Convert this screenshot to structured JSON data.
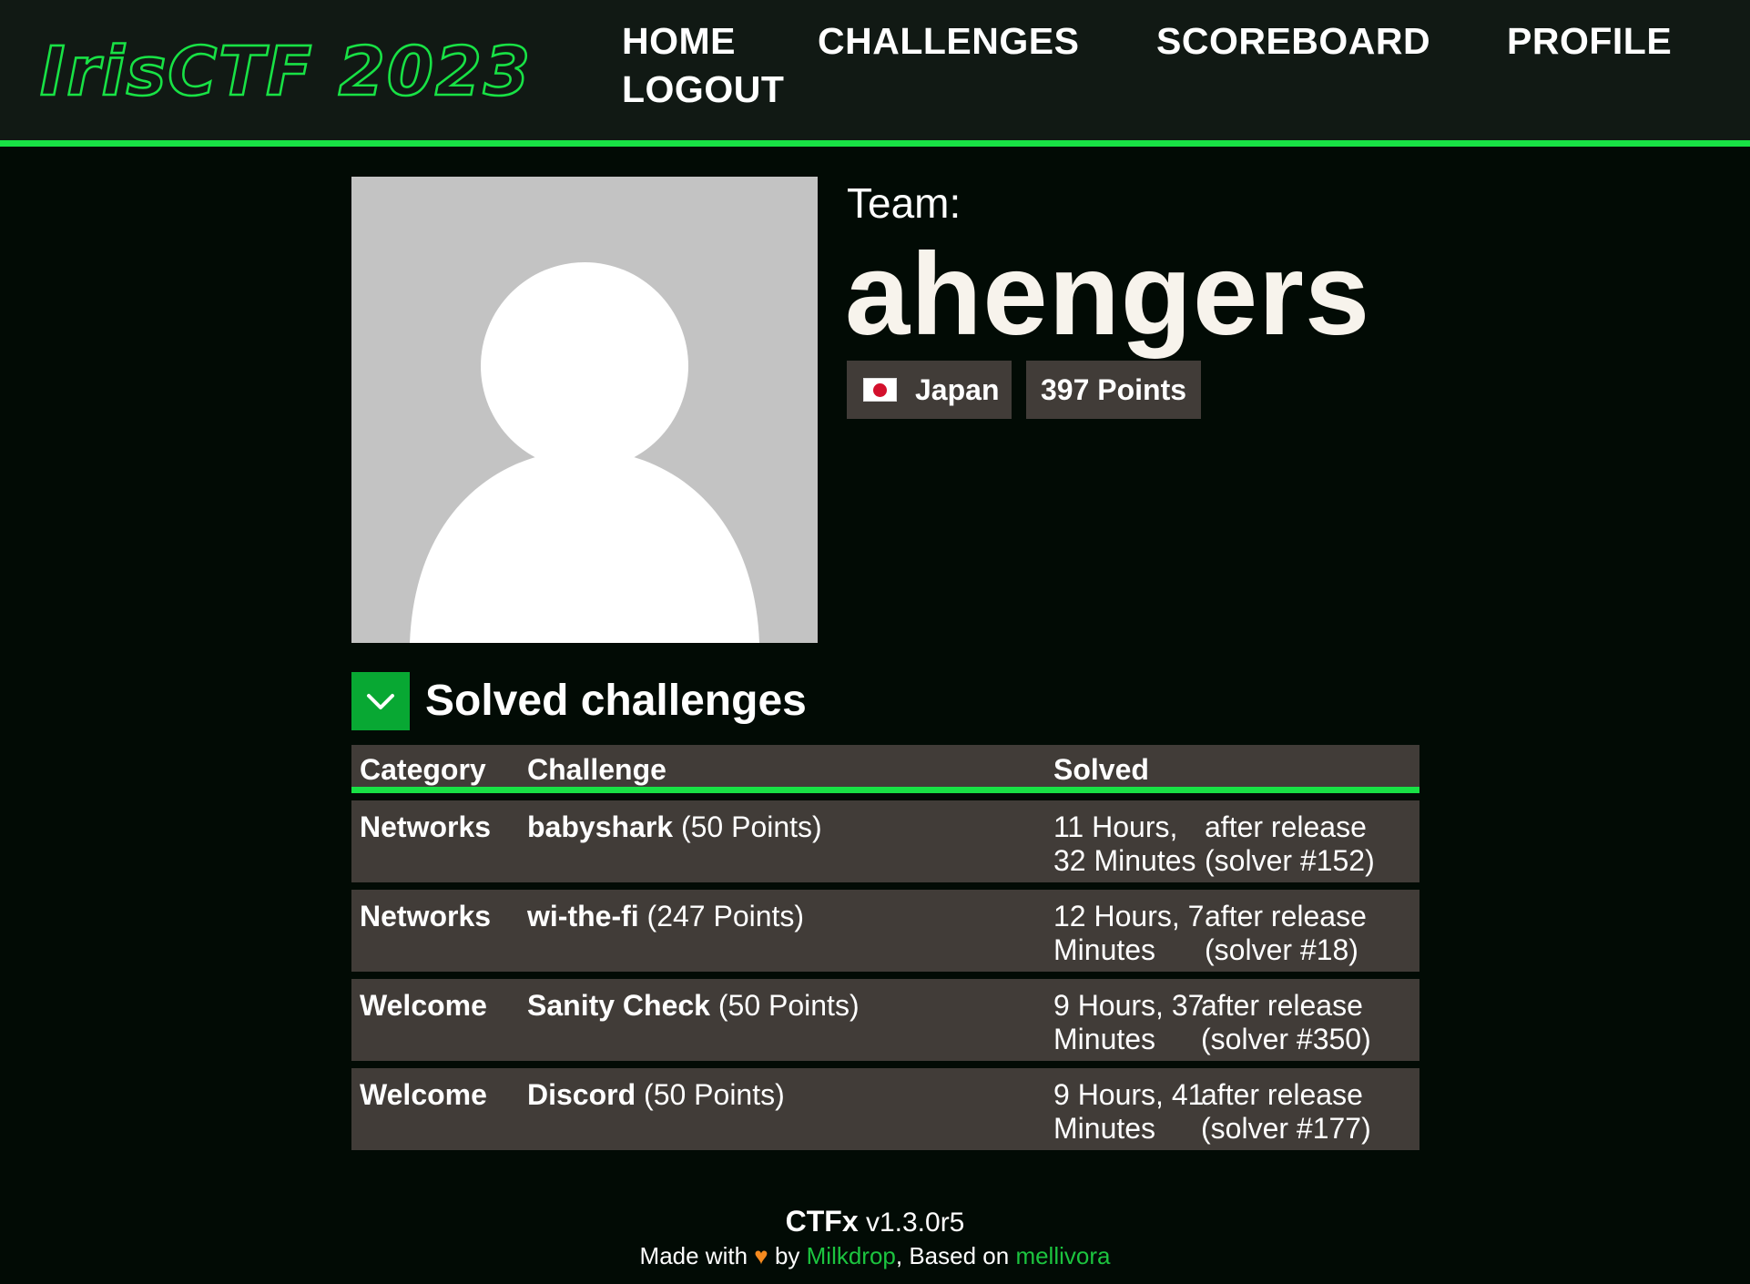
{
  "nav": {
    "logo_text": "IrisCTF 2023",
    "links": [
      "HOME",
      "CHALLENGES",
      "SCOREBOARD",
      "PROFILE",
      "LOGOUT"
    ]
  },
  "profile": {
    "team_label": "Team:",
    "team_name": "ahengers",
    "country": "Japan",
    "points": "397 Points"
  },
  "solved": {
    "title": "Solved challenges",
    "columns": [
      "Category",
      "Challenge",
      "Solved"
    ],
    "rows": [
      {
        "category": "Networks",
        "challenge": "babyshark",
        "points": "(50 Points)",
        "time1": "11 Hours,",
        "time2": "32 Minutes",
        "after1": "after release",
        "after2": "(solver #152)"
      },
      {
        "category": "Networks",
        "challenge": "wi-the-fi",
        "points": "(247 Points)",
        "time1": "12 Hours, 7",
        "time2": "Minutes",
        "after1": "after release",
        "after2": "(solver #18)"
      },
      {
        "category": "Welcome",
        "challenge": "Sanity Check",
        "points": "(50 Points)",
        "time1": "9 Hours, 37",
        "time2": "Minutes",
        "after1": "after release",
        "after2": "(solver #350)"
      },
      {
        "category": "Welcome",
        "challenge": "Discord",
        "points": "(50 Points)",
        "time1": "9 Hours, 41",
        "time2": "Minutes",
        "after1": "after release",
        "after2": "(solver #177)"
      }
    ]
  },
  "footer": {
    "brand": "CTFx",
    "version": "v1.3.0r5",
    "made_with": "Made with",
    "heart": "♥",
    "by": "by",
    "milkdrop": "Milkdrop",
    "based_on": ", Based on",
    "mellivora": "mellivora"
  },
  "colors": {
    "accent": "#18e245",
    "background": "#020b05",
    "navbar": "#111914",
    "panel": "#413c38",
    "toggle": "#08a833"
  }
}
